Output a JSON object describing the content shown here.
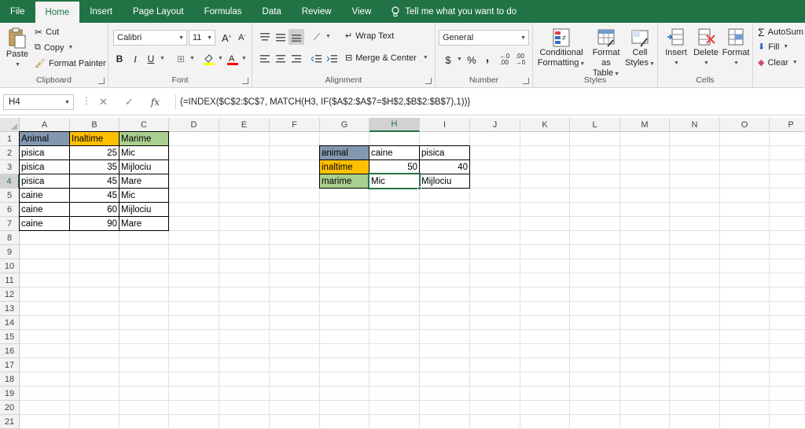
{
  "ribbon_tabs": [
    "File",
    "Home",
    "Insert",
    "Page Layout",
    "Formulas",
    "Data",
    "Review",
    "View"
  ],
  "active_tab": "Home",
  "tell_me": "Tell me what you want to do",
  "clipboard": {
    "paste": "Paste",
    "cut": "Cut",
    "copy": "Copy",
    "format_painter": "Format Painter",
    "label": "Clipboard"
  },
  "font": {
    "name": "Calibri",
    "size": "11",
    "bold": "B",
    "italic": "I",
    "underline": "U",
    "label": "Font"
  },
  "alignment": {
    "wrap_text": "Wrap Text",
    "merge_center": "Merge & Center",
    "label": "Alignment"
  },
  "number": {
    "format": "General",
    "currency": "$",
    "percent": "%",
    "comma": ",",
    "label": "Number"
  },
  "styles": {
    "conditional_1": "Conditional",
    "conditional_2": "Formatting",
    "format_as_1": "Format as",
    "format_as_2": "Table",
    "cell_styles_1": "Cell",
    "cell_styles_2": "Styles",
    "label": "Styles"
  },
  "cells": {
    "insert": "Insert",
    "delete": "Delete",
    "format": "Format",
    "label": "Cells"
  },
  "editing": {
    "autosum": "AutoSum",
    "fill": "Fill",
    "clear": "Clear"
  },
  "name_box": "H4",
  "formula": "{=INDEX($C$2:$C$7, MATCH(H3, IF($A$2:$A$7=$H$2,$B$2:$B$7),1))}",
  "columns": [
    "A",
    "B",
    "C",
    "D",
    "E",
    "F",
    "G",
    "H",
    "I",
    "J",
    "K",
    "L",
    "M",
    "N",
    "O",
    "P"
  ],
  "rows": [
    "1",
    "2",
    "3",
    "4",
    "5",
    "6",
    "7",
    "8",
    "9",
    "10",
    "11",
    "12",
    "13",
    "14",
    "15",
    "16",
    "17",
    "18",
    "19",
    "20",
    "21",
    "22"
  ],
  "selected_col": "H",
  "selected_row": "4",
  "table1": {
    "headers": [
      "Animal",
      "Inaltime",
      "Marime"
    ],
    "rows": [
      [
        "pisica",
        "25",
        "Mic"
      ],
      [
        "pisica",
        "35",
        "Mijlociu"
      ],
      [
        "pisica",
        "45",
        "Mare"
      ],
      [
        "caine",
        "45",
        "Mic"
      ],
      [
        "caine",
        "60",
        "Mijlociu"
      ],
      [
        "caine",
        "90",
        "Mare"
      ]
    ]
  },
  "table2": {
    "labels": [
      "animal",
      "inaltime",
      "marime"
    ],
    "col_h": [
      "caine",
      "50",
      "Mic"
    ],
    "col_i": [
      "pisica",
      "40",
      "Mijlociu"
    ]
  },
  "colors": {
    "excel_green": "#217346",
    "header_blue": "#8497b0",
    "header_orange": "#ffc000",
    "header_green": "#a9d08e"
  }
}
